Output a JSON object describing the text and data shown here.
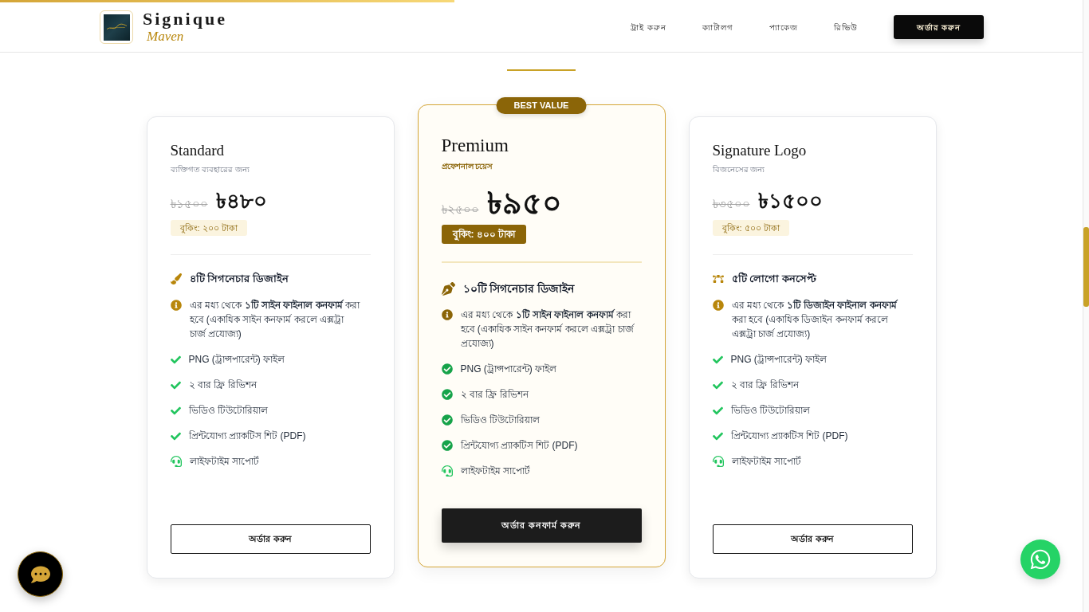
{
  "reading_progress": {
    "level": 0.42
  },
  "brand": {
    "name": "Signique",
    "tagline": "Maven"
  },
  "nav": {
    "links": [
      "ট্রাই করুন",
      "ক্যাটালগ",
      "প্যাকেজ",
      "রিভিউ"
    ],
    "cta": "অর্ডার করুন"
  },
  "plans": [
    {
      "name": "Standard",
      "subtitle": "ব্যক্তিগত ব্যবহারের জন্য",
      "old_price": "৳১৫০০",
      "price": "৳৪৮০",
      "booking": "বুকিং: ২০০ টাকা",
      "featured": false,
      "features": [
        {
          "kind": "highlight",
          "text": "৪টি সিগনেচার ডিজাইন"
        },
        {
          "kind": "info",
          "text": "এর মধ্য থেকে **১টি সাইন ফাইনাল কনফার্ম** করা হবে (একাধিক সাইন কনফার্ম করলে এক্সট্রা চার্জ প্রযোজ্য)"
        },
        {
          "kind": "check",
          "text": "PNG (ট্রান্সপারেন্ট) ফাইল"
        },
        {
          "kind": "check",
          "text": "২ বার ফ্রি রিভিশন"
        },
        {
          "kind": "check",
          "text": "ভিডিও টিউটোরিয়াল"
        },
        {
          "kind": "check",
          "text": "প্রিন্টযোগ্য প্র্যাকটিস শিট (PDF)"
        },
        {
          "kind": "support",
          "text": "লাইফটাইম সাপোর্ট"
        }
      ],
      "button": "অর্ডার করুন"
    },
    {
      "ribbon": "BEST VALUE",
      "name": "Premium",
      "subtitle": "প্রফেশনাল চয়েস",
      "old_price": "৳২৫০০",
      "price": "৳৯৫০",
      "booking": "বুকিং: ৪০০ টাকা",
      "featured": true,
      "features": [
        {
          "kind": "highlight",
          "text": "১০টি সিগনেচার ডিজাইন"
        },
        {
          "kind": "info",
          "text": "এর মধ্য থেকে **১টি সাইন ফাইনাল কনফার্ম** করা হবে (একাধিক সাইন কনফার্ম করলে এক্সট্রা চার্জ প্রযোজ্য)"
        },
        {
          "kind": "check",
          "text": "PNG (ট্রান্সপারেন্ট) ফাইল"
        },
        {
          "kind": "check",
          "text": "২ বার ফ্রি রিভিশন"
        },
        {
          "kind": "check",
          "text": "ভিডিও টিউটোরিয়াল"
        },
        {
          "kind": "check",
          "text": "প্রিন্টযোগ্য প্র্যাকটিস শিট (PDF)"
        },
        {
          "kind": "support",
          "text": "লাইফটাইম সাপোর্ট"
        }
      ],
      "button": "অর্ডার কনফার্ম করুন"
    },
    {
      "name": "Signature Logo",
      "subtitle": "বিজনেসের জন্য",
      "old_price": "৳৩৫০০",
      "price": "৳১৫০০",
      "booking": "বুকিং: ৫০০ টাকা",
      "featured": false,
      "features": [
        {
          "kind": "highlight",
          "text": "৫টি লোগো কনসেপ্ট"
        },
        {
          "kind": "info",
          "text": "এর মধ্য থেকে **১টি ডিজাইন ফাইনাল কনফার্ম** করা হবে (একাধিক ডিজাইন কনফার্ম করলে এক্সট্রা চার্জ প্রযোজ্য)"
        },
        {
          "kind": "check",
          "text": "PNG (ট্রান্সপারেন্ট) ফাইল"
        },
        {
          "kind": "check",
          "text": "২ বার ফ্রি রিভিশন"
        },
        {
          "kind": "check",
          "text": "ভিডিও টিউটোরিয়াল"
        },
        {
          "kind": "check",
          "text": "প্রিন্টযোগ্য প্র্যাকটিস শিট (PDF)"
        },
        {
          "kind": "support",
          "text": "লাইফটাইম সাপোর্ট"
        }
      ],
      "button": "অর্ডার করুন"
    }
  ]
}
